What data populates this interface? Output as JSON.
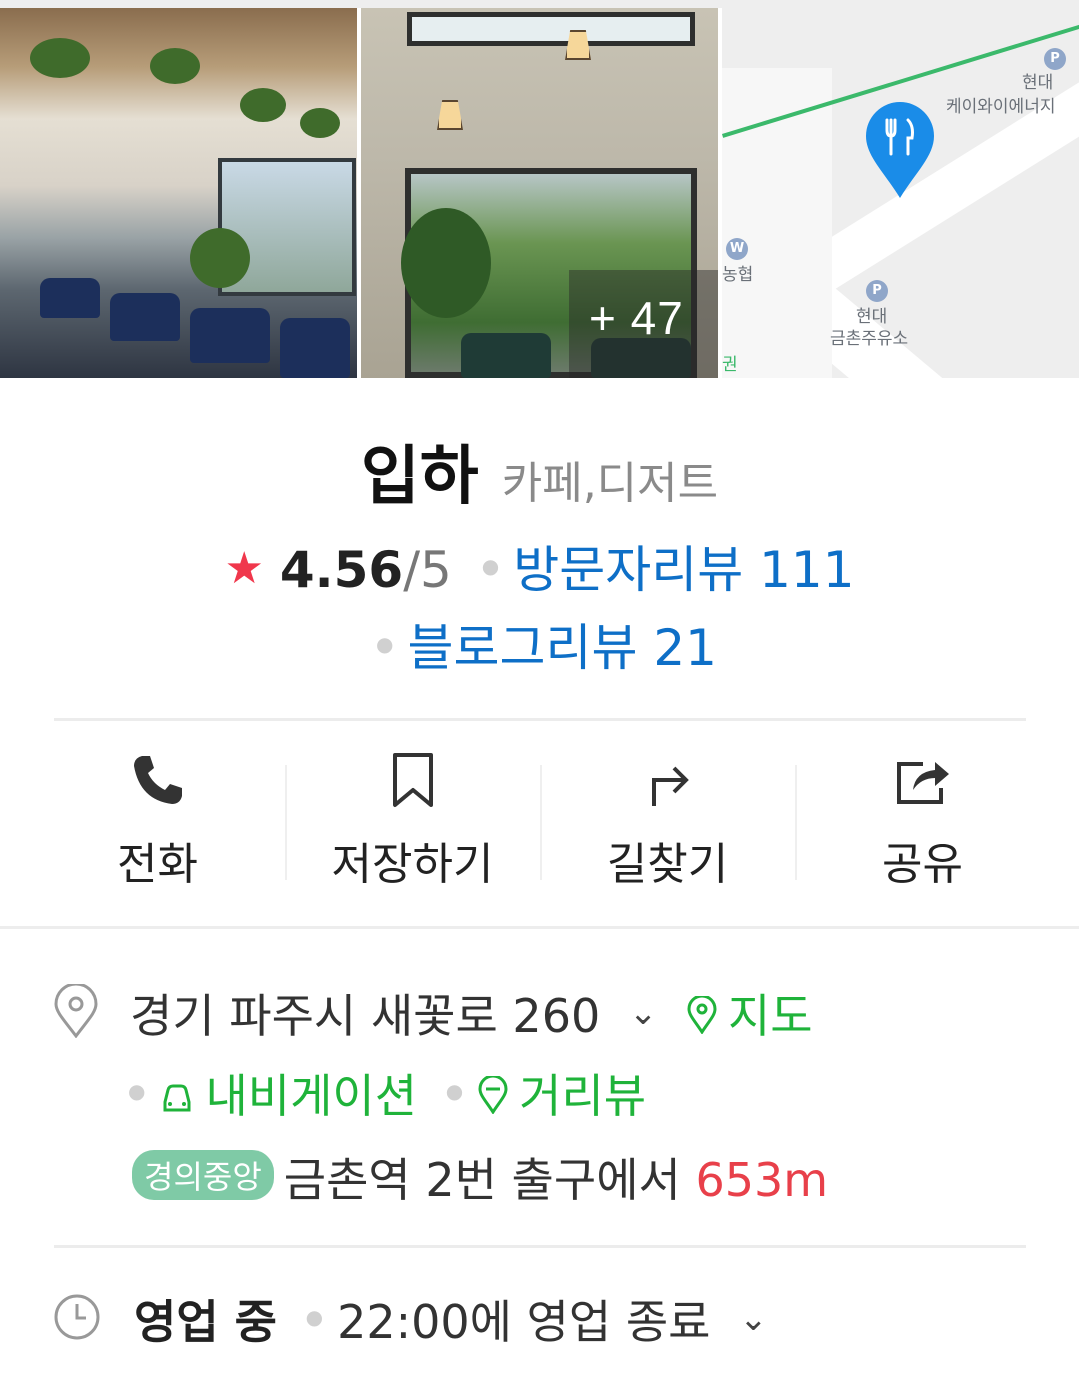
{
  "gallery": {
    "more_photos": "+ 47",
    "map": {
      "labels": [
        "현대",
        "케이와이에너지",
        "농협",
        "현대",
        "금촌주유소",
        "권"
      ]
    }
  },
  "place": {
    "name": "입하",
    "category": "카페,디저트",
    "rating": "4.56",
    "rating_max": "/5",
    "visitor_reviews": "방문자리뷰 111",
    "blog_reviews": "블로그리뷰 21"
  },
  "actions": [
    {
      "label": "전화",
      "icon": "phone-icon"
    },
    {
      "label": "저장하기",
      "icon": "bookmark-icon"
    },
    {
      "label": "길찾기",
      "icon": "directions-icon"
    },
    {
      "label": "공유",
      "icon": "share-icon"
    }
  ],
  "address": {
    "text": "경기 파주시 새꽃로 260",
    "map_link": "지도",
    "navigation_link": "내비게이션",
    "street_view_link": "거리뷰"
  },
  "transit": {
    "line": "경의중앙",
    "station": "금촌역 2번 출구에서",
    "distance": "653m"
  },
  "hours": {
    "status": "영업 중",
    "detail": "22:00에 영업 종료"
  },
  "colors": {
    "star": "#f0374c",
    "link_blue": "#0e6fc7",
    "green": "#1fb33a",
    "distance_red": "#e8404a",
    "line_badge": "#7fcaa6",
    "map_pin": "#1a8ce8"
  }
}
